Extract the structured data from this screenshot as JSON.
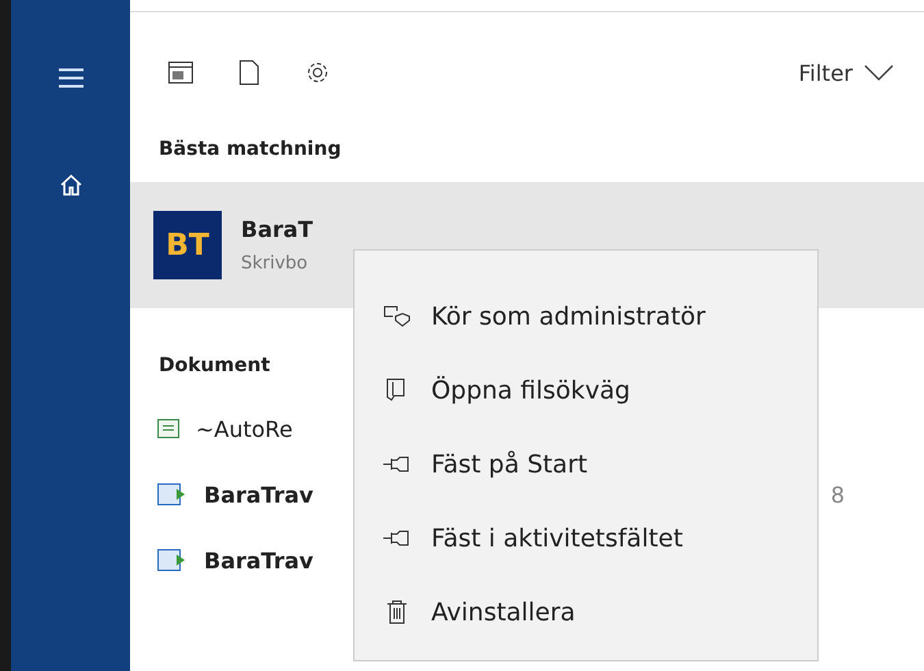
{
  "toolbar": {
    "filter": "Filter"
  },
  "best_match": {
    "heading": "Bästa matchning",
    "title": "BaraT",
    "subtitle": "Skrivbo",
    "logo": "BT",
    "selected": true
  },
  "documents": {
    "heading": "Dokument",
    "items": [
      {
        "kind": "text",
        "name": "~AutoRe"
      },
      {
        "kind": "app",
        "name": "BaraTrav",
        "trailing": "8"
      },
      {
        "kind": "app",
        "name": "BaraTrav"
      }
    ]
  },
  "context_menu": [
    {
      "kind": "admin",
      "label": "Kör som administratör"
    },
    {
      "kind": "folder",
      "label": "Öppna filsökväg"
    },
    {
      "kind": "pin",
      "label": "Fäst på Start"
    },
    {
      "kind": "pin",
      "label": "Fäst i aktivitetsfältet"
    },
    {
      "kind": "trash",
      "label": "Avinstallera"
    }
  ]
}
